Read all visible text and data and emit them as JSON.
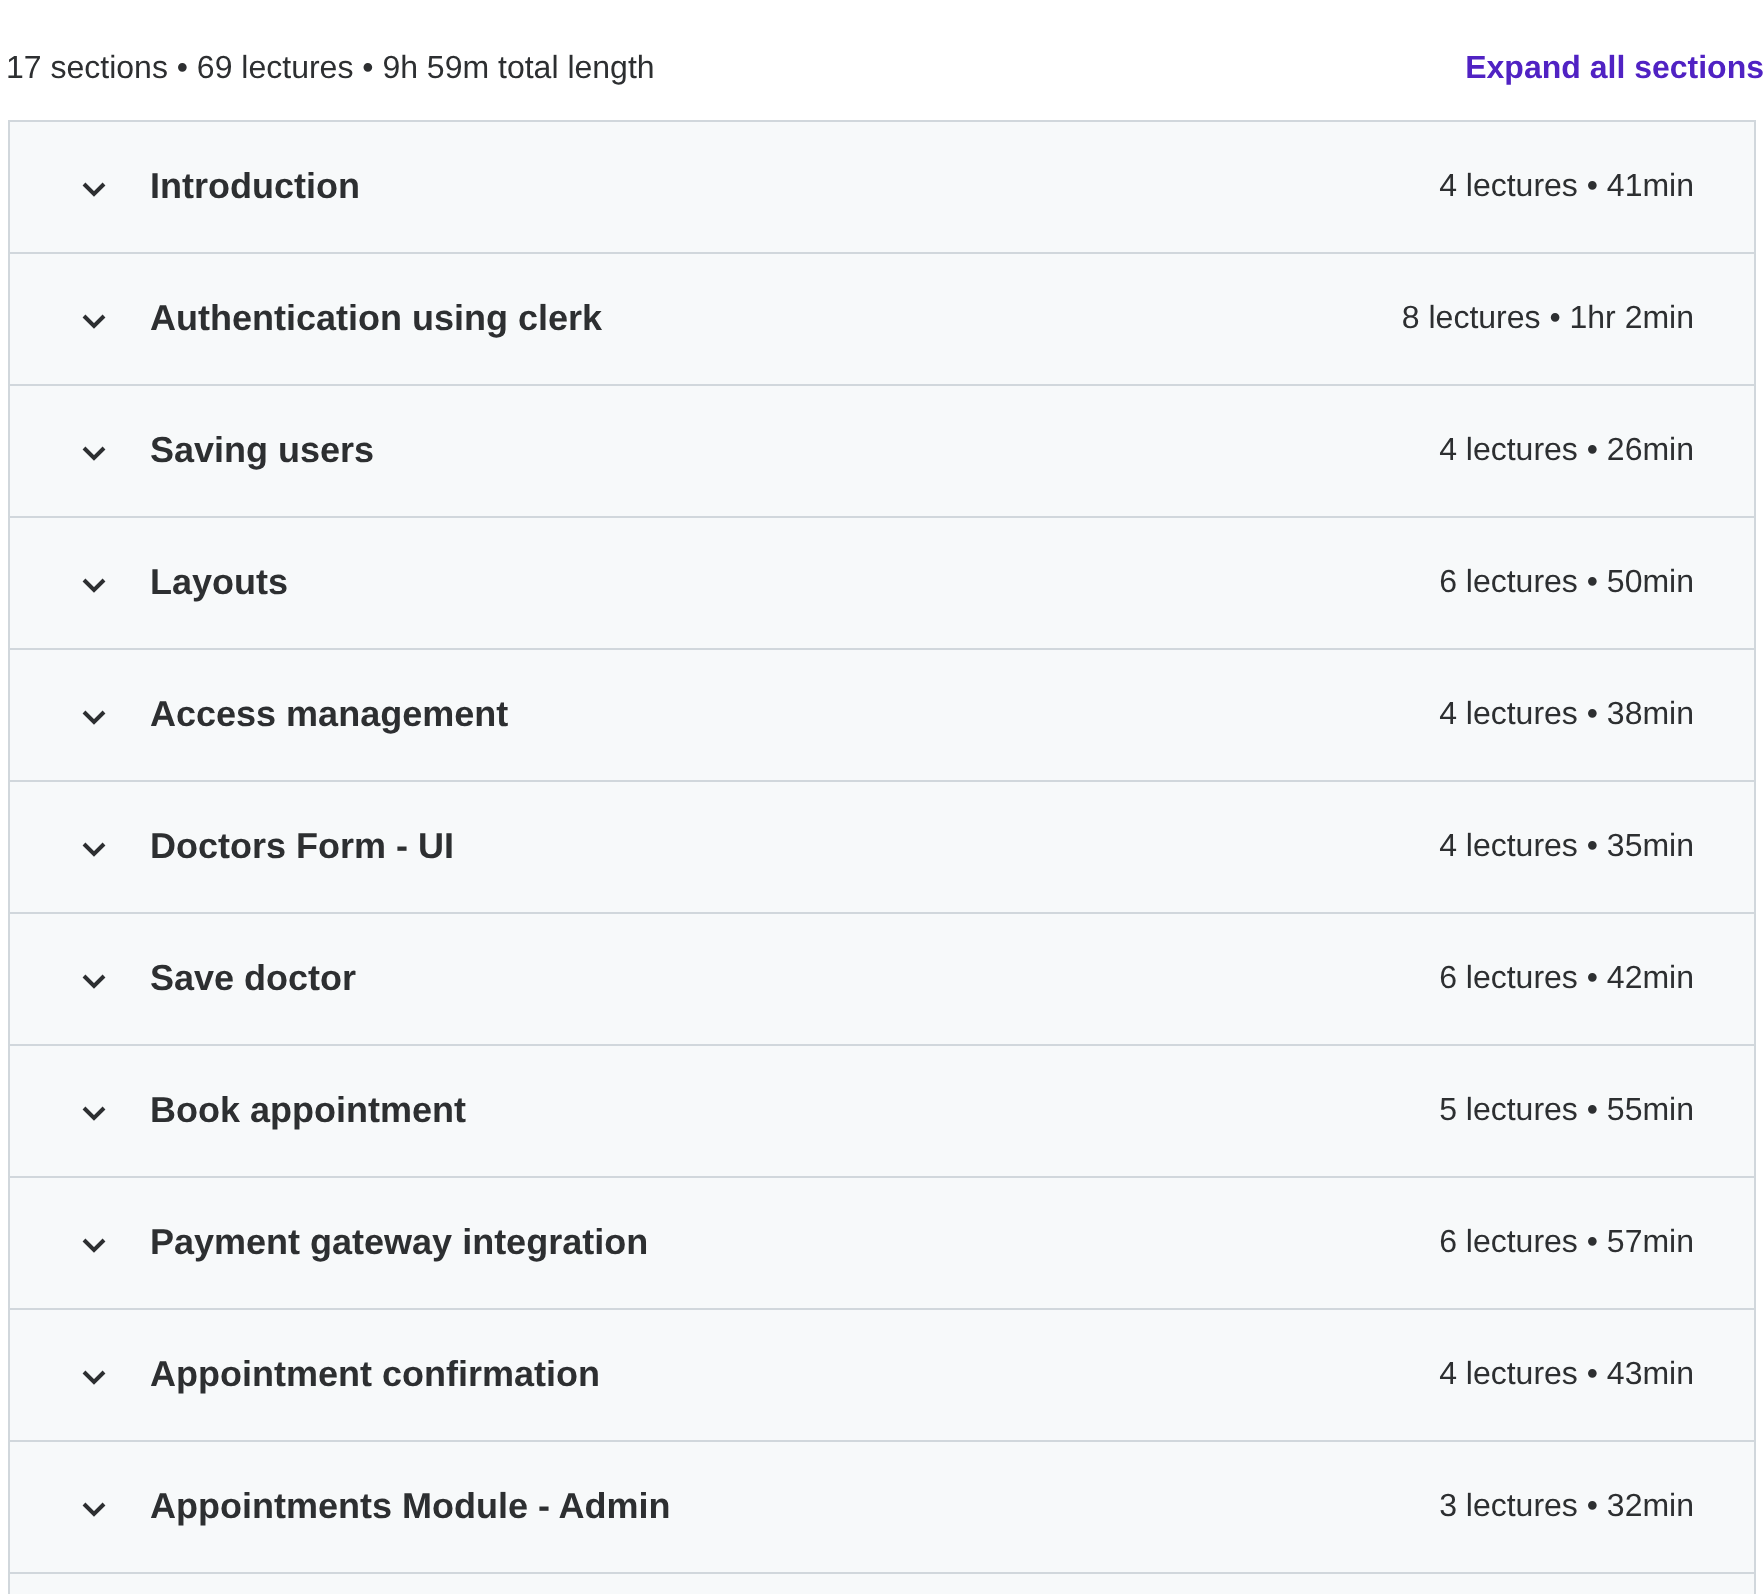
{
  "summary": "17 sections • 69 lectures • 9h 59m total length",
  "expand_link": "Expand all sections",
  "sections": [
    {
      "title": "Introduction",
      "meta": "4 lectures • 41min",
      "expanded": false
    },
    {
      "title": "Authentication using clerk",
      "meta": "8 lectures • 1hr 2min",
      "expanded": false
    },
    {
      "title": "Saving users",
      "meta": "4 lectures • 26min",
      "expanded": false
    },
    {
      "title": "Layouts",
      "meta": "6 lectures • 50min",
      "expanded": false
    },
    {
      "title": "Access management",
      "meta": "4 lectures • 38min",
      "expanded": false
    },
    {
      "title": "Doctors Form - UI",
      "meta": "4 lectures • 35min",
      "expanded": false
    },
    {
      "title": "Save doctor",
      "meta": "6 lectures • 42min",
      "expanded": false
    },
    {
      "title": "Book appointment",
      "meta": "5 lectures • 55min",
      "expanded": false
    },
    {
      "title": "Payment gateway integration",
      "meta": "6 lectures • 57min",
      "expanded": false
    },
    {
      "title": "Appointment confirmation",
      "meta": "4 lectures • 43min",
      "expanded": false
    },
    {
      "title": "Appointments Module - Admin",
      "meta": "3 lectures • 32min",
      "expanded": false
    }
  ]
}
